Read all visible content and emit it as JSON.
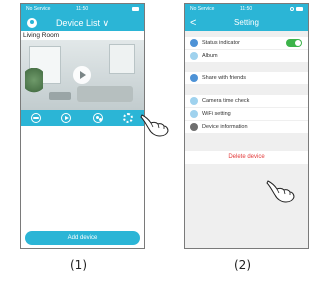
{
  "screen1": {
    "status": {
      "carrier": "No Service",
      "time": "11:50"
    },
    "nav_title": "Device List ∨",
    "device_name": "Living Room",
    "add_device_label": "Add device",
    "caption": "(1)"
  },
  "screen2": {
    "status": {
      "carrier": "No Service",
      "time": "11:50"
    },
    "nav_title": "Setting",
    "back_label": "<",
    "rows": [
      {
        "label": "Status indicator"
      },
      {
        "label": "Album"
      },
      {
        "label": "Share with friends"
      },
      {
        "label": "Camera time check"
      },
      {
        "label": "WiFi setting"
      },
      {
        "label": "Device information"
      }
    ],
    "status_indicator_on": true,
    "delete_label": "Delete device",
    "caption": "(2)"
  },
  "colors": {
    "accent": "#2bb5d6",
    "toggle_on": "#3cb34a",
    "danger": "#e33b3b"
  },
  "icons": {
    "action_bar": [
      "cloud-icon",
      "playback-icon",
      "share-icon",
      "settings-gear-icon"
    ],
    "pointer": "pointing-hand-icon"
  }
}
